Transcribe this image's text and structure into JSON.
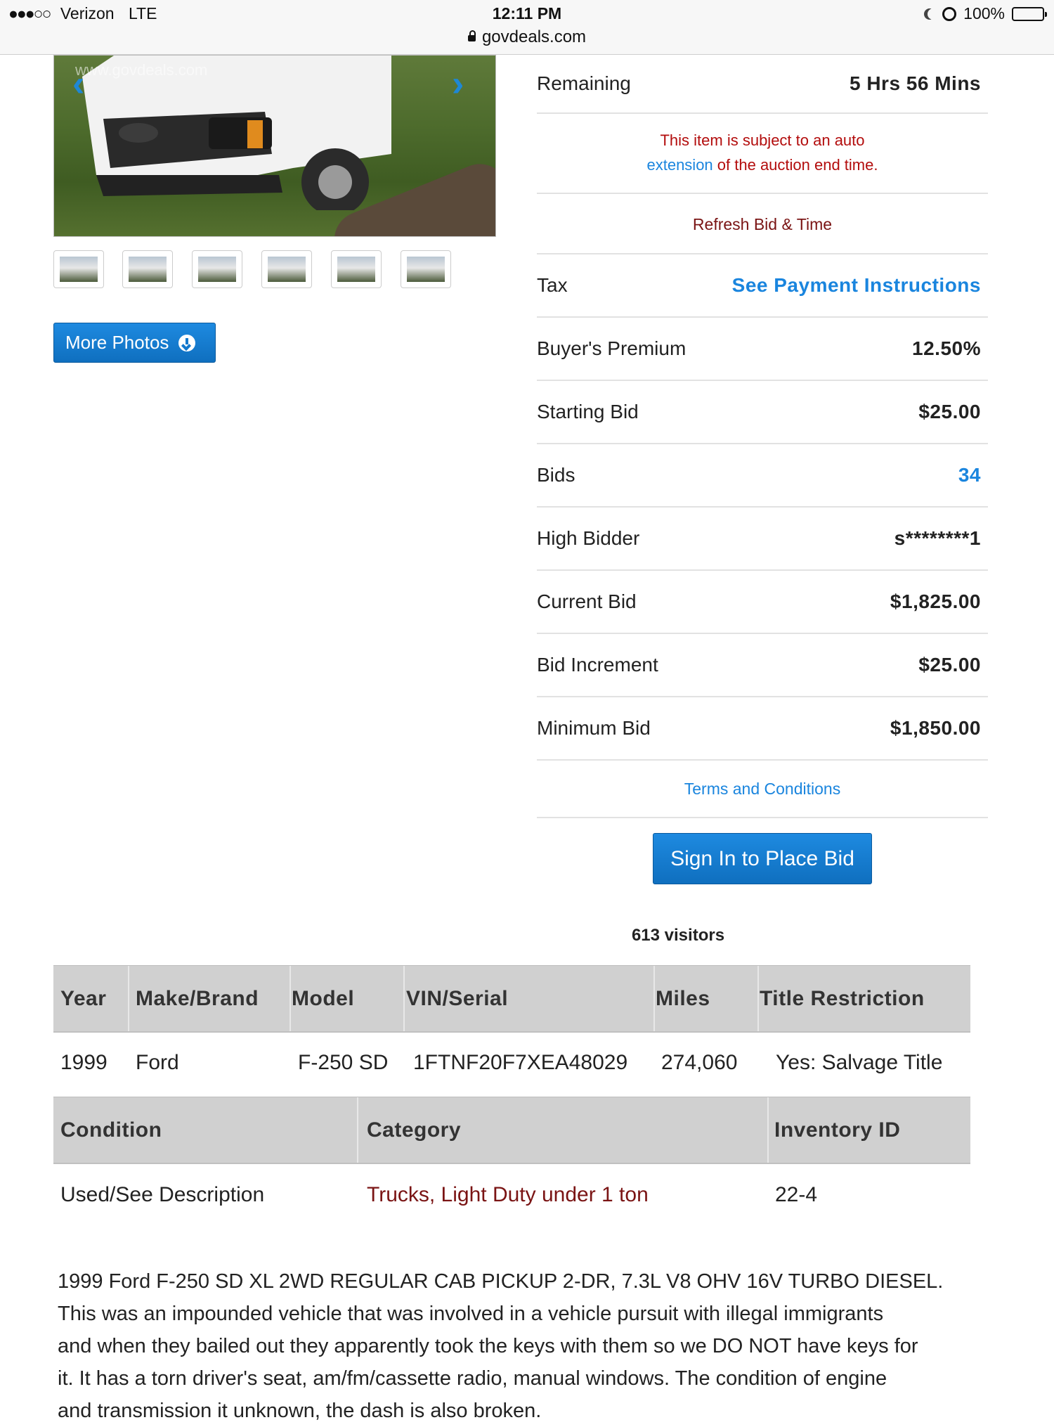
{
  "status_bar": {
    "signal": "●●●○○",
    "carrier": "Verizon",
    "network": "LTE",
    "time": "12:11 PM",
    "url": "govdeals.com",
    "battery": "100%"
  },
  "gallery": {
    "watermark": "www.govdeals.com",
    "more_photos_label": "More Photos",
    "thumbnail_count": 6
  },
  "bid_panel": {
    "remaining_label": "Remaining",
    "remaining_value": "5 Hrs 56 Mins",
    "notice_line1": "This item is subject to an auto",
    "notice_link": "extension",
    "notice_line2_rest": " of the auction end time.",
    "refresh_label": "Refresh Bid & Time",
    "rows": [
      {
        "label": "Tax",
        "value": "See Payment Instructions"
      },
      {
        "label": "Buyer's Premium",
        "value": "12.50%"
      },
      {
        "label": "Starting Bid",
        "value": "$25.00"
      },
      {
        "label": "Bids",
        "value": "34"
      },
      {
        "label": "High Bidder",
        "value": "s********1"
      },
      {
        "label": "Current Bid",
        "value": "$1,825.00"
      },
      {
        "label": "Bid Increment",
        "value": "$25.00"
      },
      {
        "label": "Minimum Bid",
        "value": "$1,850.00"
      }
    ],
    "terms_label": "Terms and Conditions",
    "sign_in_label": "Sign In to Place Bid",
    "visitors": "613 visitors"
  },
  "specs": {
    "headers1": [
      "Year",
      "Make/Brand",
      "Model",
      "VIN/Serial",
      "Miles",
      "Title Restriction"
    ],
    "values1": [
      "1999",
      "Ford",
      "F-250 SD",
      "1FTNF20F7XEA48029",
      "274,060",
      "Yes: Salvage Title"
    ],
    "headers2": [
      "Condition",
      "Category",
      "Inventory ID"
    ],
    "values2": [
      "Used/See Description",
      "Trucks, Light Duty under 1 ton",
      "22-4"
    ]
  },
  "description": {
    "lines": [
      "1999 Ford F-250 SD XL 2WD REGULAR CAB PICKUP 2-DR, 7.3L V8 OHV 16V TURBO DIESEL.",
      "This was an impounded vehicle that was involved in a vehicle pursuit with illegal immigrants",
      "and when they bailed out they apparently took the keys with them so we DO NOT have keys for",
      "it. It has a torn driver's seat, am/fm/cassette radio, manual windows. The condition of engine",
      "and transmission it unknown, the dash is also broken."
    ]
  },
  "colors": {
    "link_blue": "#1a85de",
    "button_blue": "#1378cd",
    "alert_red": "#b30d0d",
    "dark_red": "#7a1414",
    "table_header_gray": "#d0d0d0"
  }
}
